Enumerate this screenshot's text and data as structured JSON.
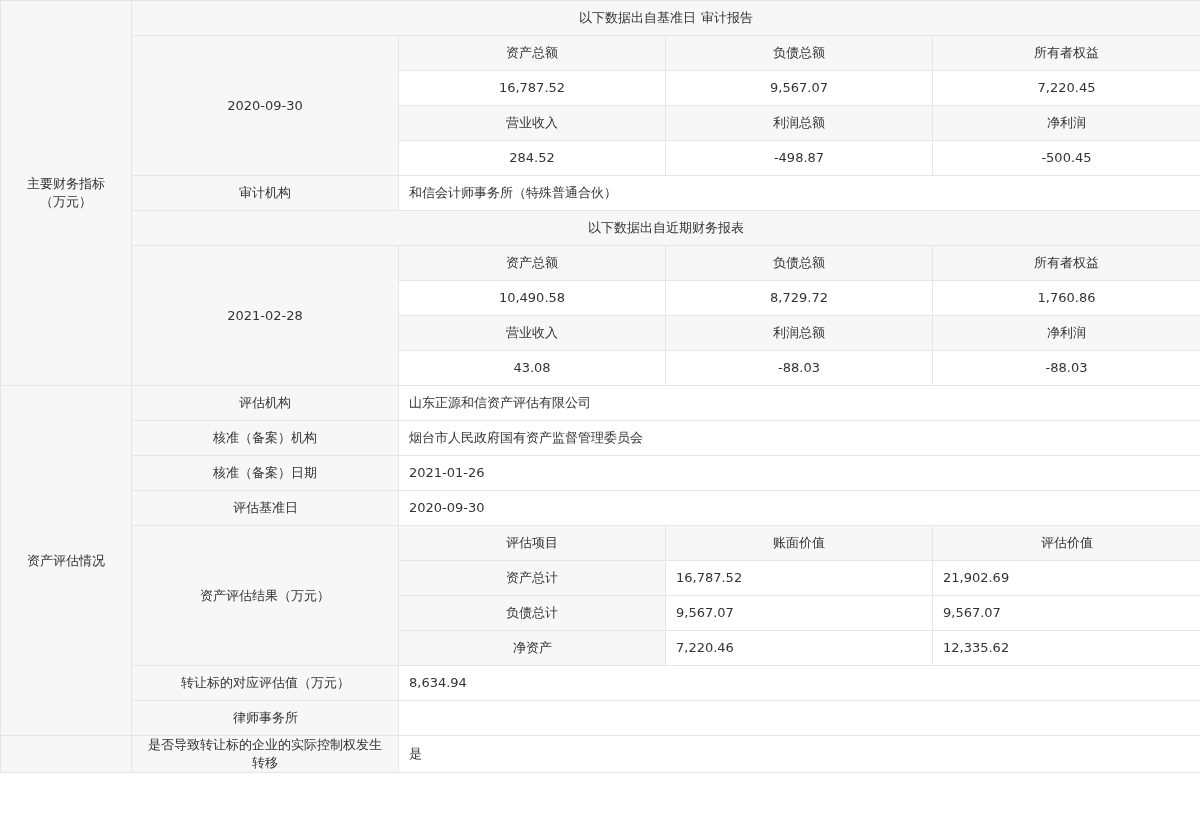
{
  "sections": [
    {
      "label": "主要财务指标",
      "unit": "（万元）",
      "rows": [
        {
          "kind": "title",
          "text": "以下数据出自基准日 审计报告"
        },
        {
          "kind": "metrics",
          "date": "2020-09-30",
          "cells": [
            {
              "header": "资产总额",
              "value": "16,787.52"
            },
            {
              "header": "负债总额",
              "value": "9,567.07"
            },
            {
              "header": "所有者权益",
              "value": "7,220.45"
            },
            {
              "header": "营业收入",
              "value": "284.52"
            },
            {
              "header": "利润总额",
              "value": "-498.87"
            },
            {
              "header": "净利润",
              "value": "-500.45"
            }
          ]
        },
        {
          "kind": "field",
          "label": "审计机构",
          "value": "和信会计师事务所（特殊普通合伙）"
        },
        {
          "kind": "title",
          "text": "以下数据出自近期财务报表"
        },
        {
          "kind": "metrics",
          "date": "2021-02-28",
          "cells": [
            {
              "header": "资产总额",
              "value": "10,490.58"
            },
            {
              "header": "负债总额",
              "value": "8,729.72"
            },
            {
              "header": "所有者权益",
              "value": "1,760.86"
            },
            {
              "header": "营业收入",
              "value": "43.08"
            },
            {
              "header": "利润总额",
              "value": "-88.03"
            },
            {
              "header": "净利润",
              "value": "-88.03"
            }
          ]
        }
      ]
    },
    {
      "label": "资产评估情况",
      "rows": [
        {
          "kind": "field",
          "label": "评估机构",
          "value": "山东正源和信资产评估有限公司"
        },
        {
          "kind": "field",
          "label": "核准（备案）机构",
          "value": "烟台市人民政府国有资产监督管理委员会"
        },
        {
          "kind": "field",
          "label": "核准（备案）日期",
          "value": "2021-01-26"
        },
        {
          "kind": "field",
          "label": "评估基准日",
          "value": "2020-09-30"
        },
        {
          "kind": "results",
          "label": "资产评估结果（万元）",
          "headers": [
            "评估项目",
            "账面价值",
            "评估价值"
          ],
          "rows": [
            [
              "资产总计",
              "16,787.52",
              "21,902.69"
            ],
            [
              "负债总计",
              "9,567.07",
              "9,567.07"
            ],
            [
              "净资产",
              "7,220.46",
              "12,335.62"
            ]
          ]
        },
        {
          "kind": "field",
          "label": "转让标的对应评估值（万元）",
          "value": "8,634.94"
        },
        {
          "kind": "field",
          "label": "律师事务所"
        }
      ]
    },
    {
      "rows": [
        {
          "kind": "field",
          "label": "是否导致转让标的企业的实际控制权发生转移",
          "value": "是"
        }
      ]
    }
  ]
}
